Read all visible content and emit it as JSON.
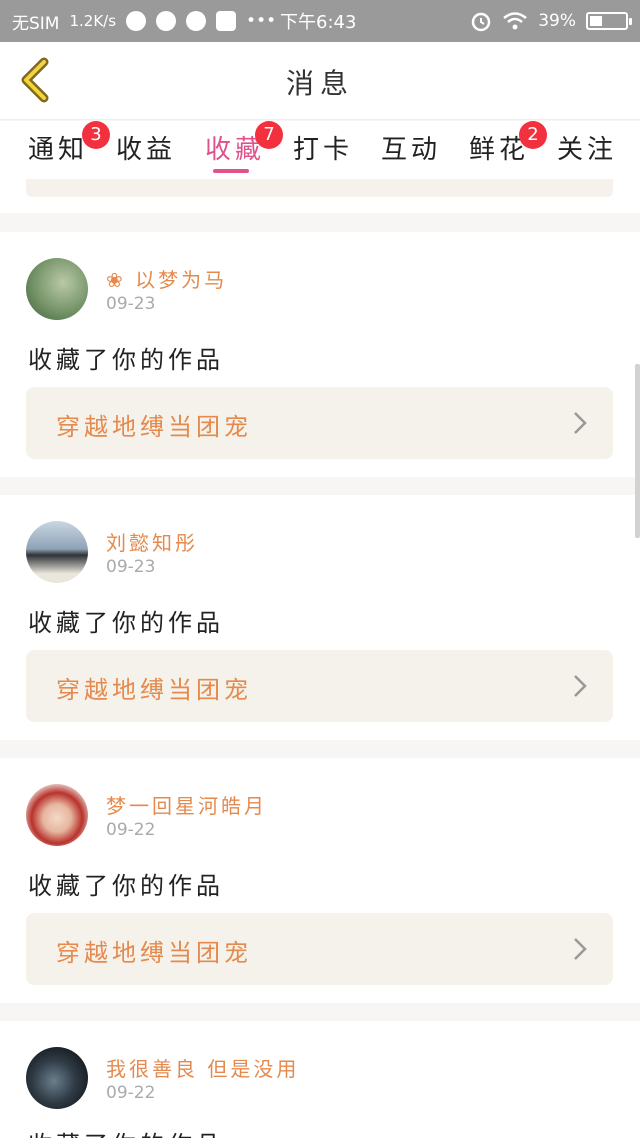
{
  "status_bar": {
    "carrier": "无SIM",
    "speed": "1.2K/s",
    "time": "下午6:43",
    "battery": "39%"
  },
  "header": {
    "title": "消息"
  },
  "tabs": [
    {
      "label": "通知",
      "badge": "3"
    },
    {
      "label": "收益",
      "badge": ""
    },
    {
      "label": "收藏",
      "badge": "7",
      "active": true
    },
    {
      "label": "打卡",
      "badge": ""
    },
    {
      "label": "互动",
      "badge": ""
    },
    {
      "label": "鲜花",
      "badge": "2"
    },
    {
      "label": "关注",
      "badge": ""
    }
  ],
  "messages": [
    {
      "name": "❀ 以梦为马",
      "date": "09-23",
      "action": "收藏了你的作品",
      "work": "穿越地缚当团宠"
    },
    {
      "name": "刘懿知彤",
      "date": "09-23",
      "action": "收藏了你的作品",
      "work": "穿越地缚当团宠"
    },
    {
      "name": "梦一回星河皓月",
      "date": "09-22",
      "action": "收藏了你的作品",
      "work": "穿越地缚当团宠"
    },
    {
      "name": "我很善良 但是没用",
      "date": "09-22",
      "action": "收藏了你的作品",
      "work": ""
    }
  ],
  "colors": {
    "accent": "#e0528b",
    "username": "#e58a4e",
    "badge": "#f2303e",
    "link_bg": "#f4f2ea"
  }
}
